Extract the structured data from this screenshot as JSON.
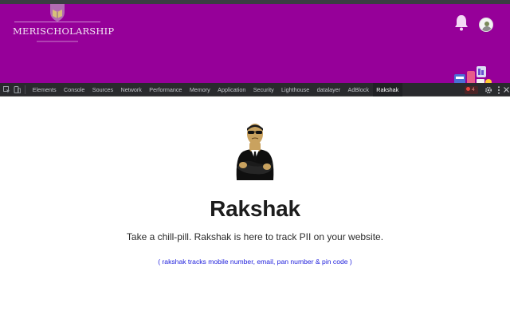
{
  "site": {
    "logo_text": "MERISCHOLARSHIP",
    "header_bg": "#960099",
    "icons": [
      "bell-icon",
      "avatar"
    ]
  },
  "devtools": {
    "tabs": [
      {
        "label": "Elements"
      },
      {
        "label": "Console"
      },
      {
        "label": "Sources"
      },
      {
        "label": "Network"
      },
      {
        "label": "Performance"
      },
      {
        "label": "Memory"
      },
      {
        "label": "Application"
      },
      {
        "label": "Security"
      },
      {
        "label": "Lighthouse"
      },
      {
        "label": "datalayer"
      },
      {
        "label": "AdBlock"
      },
      {
        "label": "Rakshak"
      }
    ],
    "active_tab": "Rakshak",
    "error_count": "4",
    "toolbar_icons": [
      "inspect-icon",
      "device-toggle-icon",
      "settings-icon",
      "more-vert-icon",
      "close-icon"
    ]
  },
  "panel": {
    "title": "Rakshak",
    "subtitle": "Take a chill-pill. Rakshak is here to track PII on your website.",
    "note": "( rakshak tracks mobile number, email, pan number & pin code )",
    "note_color": "#2222dd"
  }
}
